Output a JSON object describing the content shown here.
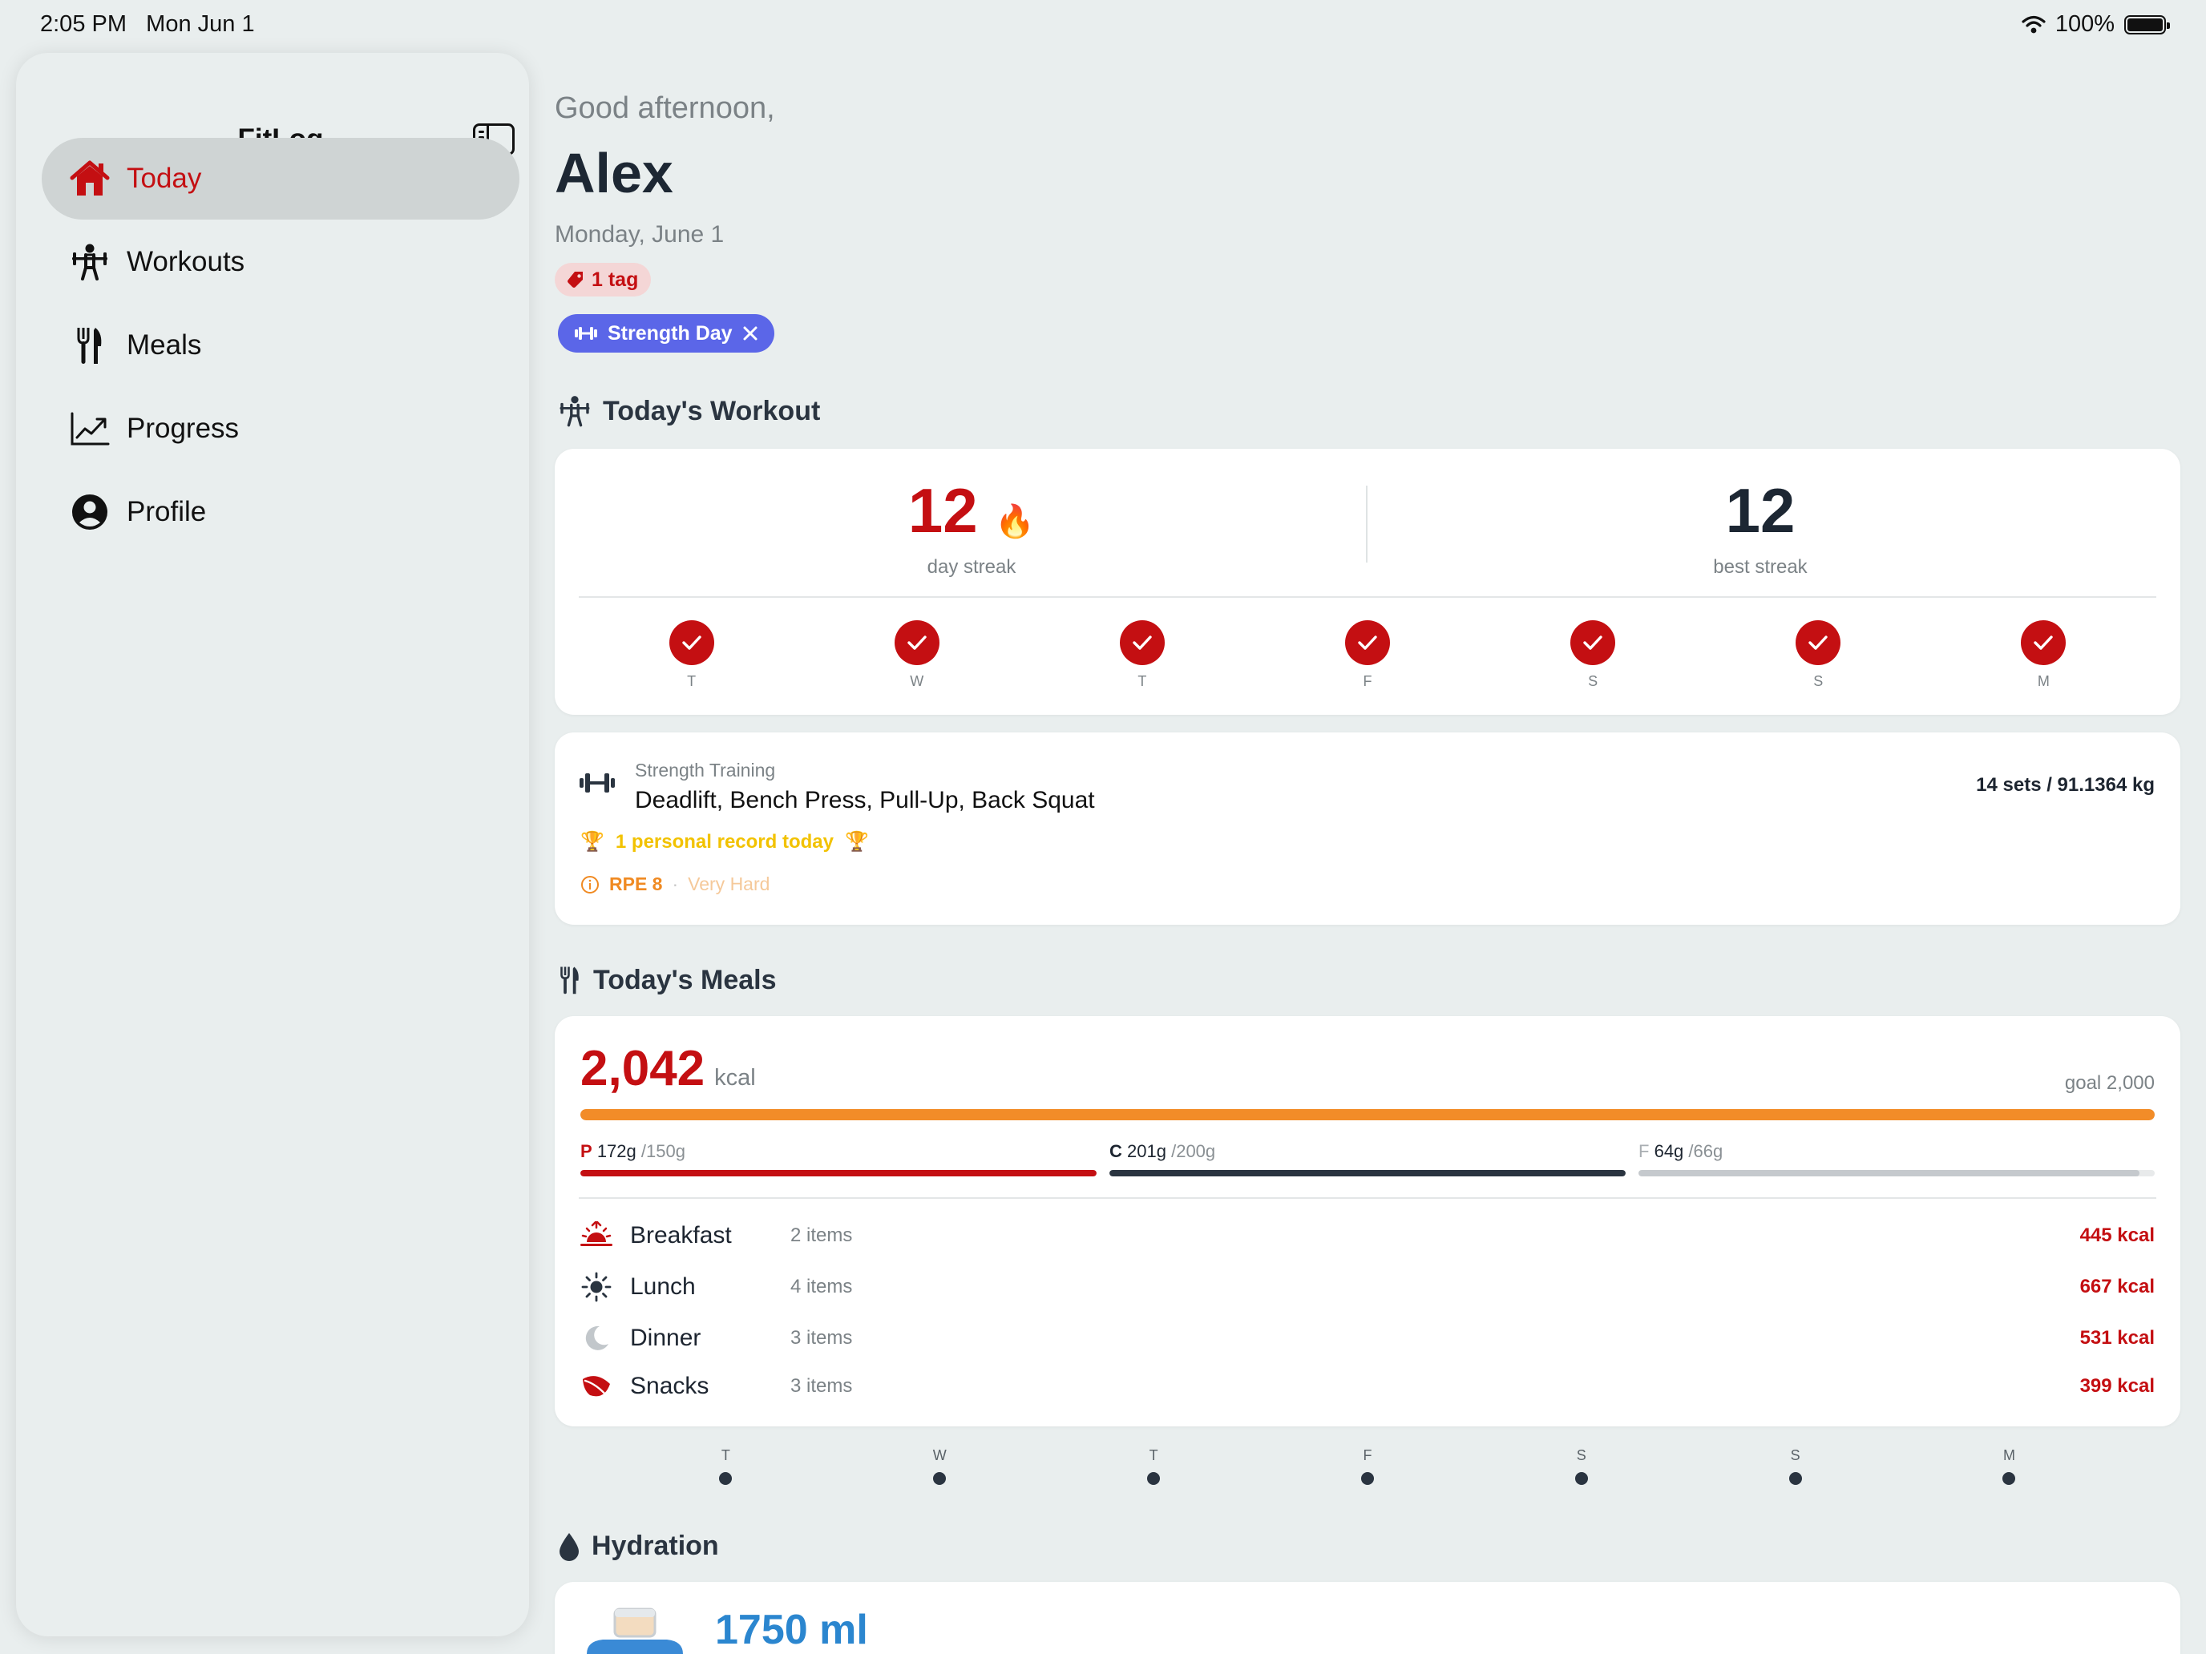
{
  "status": {
    "time": "2:05 PM",
    "date": "Mon Jun 1",
    "battery": "100%"
  },
  "sidebar": {
    "title": "FitLog",
    "items": [
      {
        "label": "Today",
        "icon": "house-icon",
        "active": true
      },
      {
        "label": "Workouts",
        "icon": "figure-strength-icon",
        "active": false
      },
      {
        "label": "Meals",
        "icon": "fork-knife-icon",
        "active": false
      },
      {
        "label": "Progress",
        "icon": "chart-line-icon",
        "active": false
      },
      {
        "label": "Profile",
        "icon": "person-circle-icon",
        "active": false
      }
    ]
  },
  "header": {
    "greeting": "Good afternoon,",
    "name": "Alex",
    "date": "Monday, June 1",
    "tag_badge": "1 tag",
    "chip": "Strength Day"
  },
  "workout": {
    "section_title": "Today's Workout",
    "streak": {
      "value": "12",
      "label": "day streak",
      "emoji": "🔥"
    },
    "best": {
      "value": "12",
      "label": "best streak"
    },
    "days": [
      "T",
      "W",
      "T",
      "F",
      "S",
      "S",
      "M"
    ],
    "type": "Strength Training",
    "exercises": "Deadlift, Bench Press, Pull-Up, Back Squat",
    "volume": "14 sets / 91.1364 kg",
    "pr": "1 personal record today",
    "rpe": "RPE 8",
    "rpe_separator": "·",
    "rpe_desc": "Very Hard"
  },
  "meals": {
    "section_title": "Today's Meals",
    "kcal": "2,042",
    "kcal_unit": "kcal",
    "goal": "goal 2,000",
    "kcal_progress": 1.0,
    "macros": [
      {
        "letter": "P",
        "value": "172g",
        "goal": "/150g",
        "progress": 1.0,
        "color": "#c40f12"
      },
      {
        "letter": "C",
        "value": "201g",
        "goal": "/200g",
        "progress": 1.0,
        "color": "#2a3440"
      },
      {
        "letter": "F",
        "value": "64g",
        "goal": "/66g",
        "progress": 0.97,
        "color": "#c5c9cd"
      }
    ],
    "list": [
      {
        "name": "Breakfast",
        "count": "2 items",
        "kcal": "445 kcal",
        "icon": "sunrise-icon"
      },
      {
        "name": "Lunch",
        "count": "4 items",
        "kcal": "667 kcal",
        "icon": "sun-icon"
      },
      {
        "name": "Dinner",
        "count": "3 items",
        "kcal": "531 kcal",
        "icon": "moon-icon"
      },
      {
        "name": "Snacks",
        "count": "3 items",
        "kcal": "399 kcal",
        "icon": "leaf-icon"
      }
    ],
    "week_days": [
      "T",
      "W",
      "T",
      "F",
      "S",
      "S",
      "M"
    ]
  },
  "hydration": {
    "section_title": "Hydration",
    "amount": "1750 ml"
  },
  "colors": {
    "accent": "#c40f12",
    "chip": "#5b66e8",
    "calories_bar": "#f28c28",
    "water": "#2b86cf"
  }
}
